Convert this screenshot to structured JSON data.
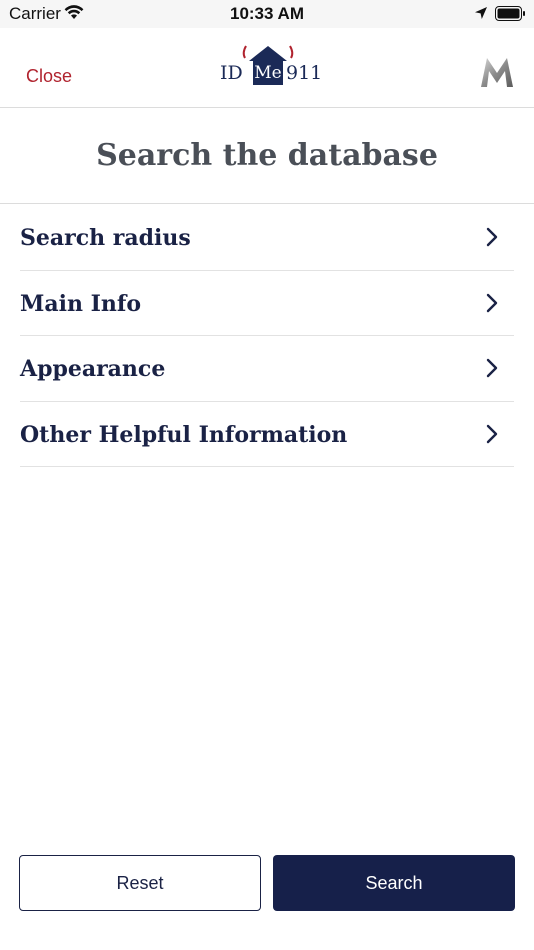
{
  "status_bar": {
    "carrier": "Carrier",
    "time": "10:33 AM",
    "icons": [
      "wifi-icon",
      "location-arrow-icon",
      "battery-icon"
    ]
  },
  "nav": {
    "close_label": "Close",
    "logo": {
      "left": "ID",
      "middle": "Me",
      "right": "911"
    },
    "brand_icon": "brand-m-icon"
  },
  "page": {
    "title": "Search the database"
  },
  "menu": {
    "items": [
      {
        "label": "Search radius",
        "icon": "chevron-right-icon"
      },
      {
        "label": "Main Info",
        "icon": "chevron-right-icon"
      },
      {
        "label": "Appearance",
        "icon": "chevron-right-icon"
      },
      {
        "label": "Other Helpful Information",
        "icon": "chevron-right-icon"
      }
    ]
  },
  "actions": {
    "reset_label": "Reset",
    "search_label": "Search"
  },
  "colors": {
    "accent_red": "#b0232e",
    "navy": "#16204a",
    "title_gray": "#4a4f57"
  }
}
